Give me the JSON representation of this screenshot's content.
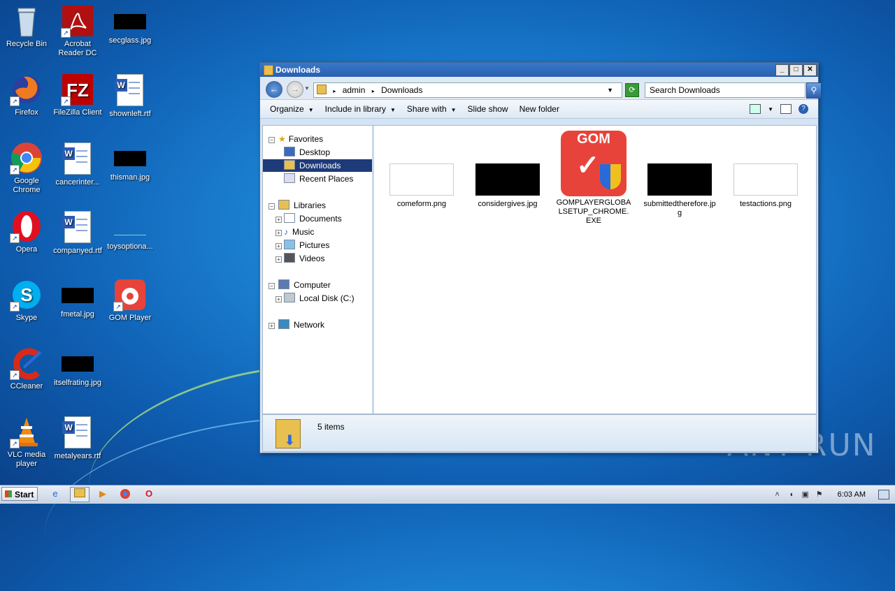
{
  "desktop": {
    "icons": [
      {
        "label": "Recycle Bin"
      },
      {
        "label": "Acrobat Reader DC"
      },
      {
        "label": "secglass.jpg"
      },
      {
        "label": "Firefox"
      },
      {
        "label": "FileZilla Client"
      },
      {
        "label": "shownleft.rtf"
      },
      {
        "label": "Google Chrome"
      },
      {
        "label": "cancerinter..."
      },
      {
        "label": "thisman.jpg"
      },
      {
        "label": "Opera"
      },
      {
        "label": "companyed.rtf"
      },
      {
        "label": "toysoptiona..."
      },
      {
        "label": "Skype"
      },
      {
        "label": "fmetal.jpg"
      },
      {
        "label": "GOM Player"
      },
      {
        "label": "CCleaner"
      },
      {
        "label": "itselfrating.jpg"
      },
      {
        "label": "VLC media player"
      },
      {
        "label": "metalyears.rtf"
      }
    ],
    "watermark": "ANY RUN"
  },
  "window": {
    "title": "Downloads",
    "breadcrumb": [
      "admin",
      "Downloads"
    ],
    "search_placeholder": "Search Downloads",
    "toolbar": {
      "organize": "Organize",
      "include": "Include in library",
      "share": "Share with",
      "slideshow": "Slide show",
      "newfolder": "New folder"
    },
    "nav": {
      "favorites": "Favorites",
      "desktop": "Desktop",
      "downloads": "Downloads",
      "recent": "Recent Places",
      "libraries": "Libraries",
      "documents": "Documents",
      "music": "Music",
      "pictures": "Pictures",
      "videos": "Videos",
      "computer": "Computer",
      "localdisk": "Local Disk (C:)",
      "network": "Network"
    },
    "files": [
      {
        "name": "comeform.png"
      },
      {
        "name": "considergives.jpg"
      },
      {
        "name": "GOMPLAYERGLOBALSETUP_CHROME.EXE",
        "logo_text": "GOM"
      },
      {
        "name": "submittedtherefore.jpg"
      },
      {
        "name": "testactions.png"
      }
    ],
    "status": "5 items"
  },
  "taskbar": {
    "start": "Start",
    "clock": "6:03 AM"
  },
  "colors": {
    "selected_nav": "#1e3a78",
    "gom_red": "#e8433a"
  }
}
